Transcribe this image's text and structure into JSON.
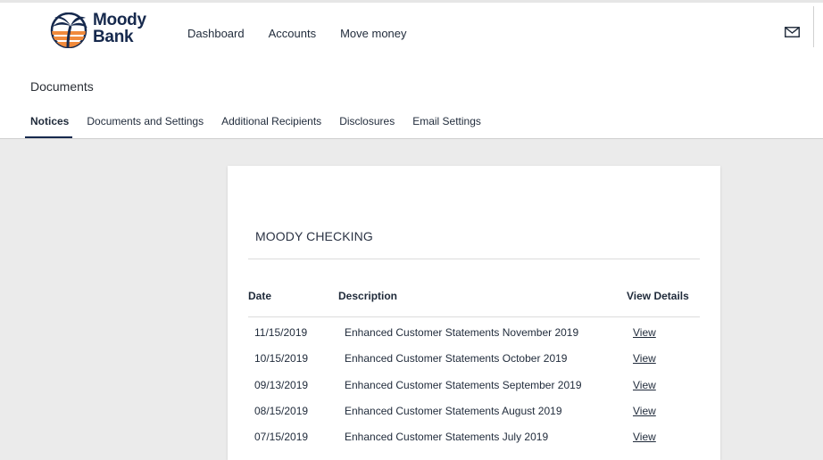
{
  "brand": {
    "line1": "Moody",
    "line2": "Bank",
    "navy": "#16294d",
    "orange": "#f08a3c"
  },
  "nav": {
    "items": [
      "Dashboard",
      "Accounts",
      "Move money"
    ],
    "mail_icon": "mail-icon"
  },
  "page": {
    "title": "Documents"
  },
  "tabs": [
    {
      "label": "Notices",
      "active": true
    },
    {
      "label": "Documents and Settings",
      "active": false
    },
    {
      "label": "Additional Recipients",
      "active": false
    },
    {
      "label": "Disclosures",
      "active": false
    },
    {
      "label": "Email Settings",
      "active": false
    }
  ],
  "card": {
    "title": "MOODY CHECKING",
    "headers": {
      "date": "Date",
      "description": "Description",
      "view": "View Details"
    },
    "rows": [
      {
        "date": "11/15/2019",
        "description": "Enhanced Customer Statements November 2019",
        "view": "View"
      },
      {
        "date": "10/15/2019",
        "description": "Enhanced Customer Statements October 2019",
        "view": "View"
      },
      {
        "date": "09/13/2019",
        "description": "Enhanced Customer Statements September 2019",
        "view": "View"
      },
      {
        "date": "08/15/2019",
        "description": "Enhanced Customer Statements August 2019",
        "view": "View"
      },
      {
        "date": "07/15/2019",
        "description": "Enhanced Customer Statements July 2019",
        "view": "View"
      }
    ]
  }
}
